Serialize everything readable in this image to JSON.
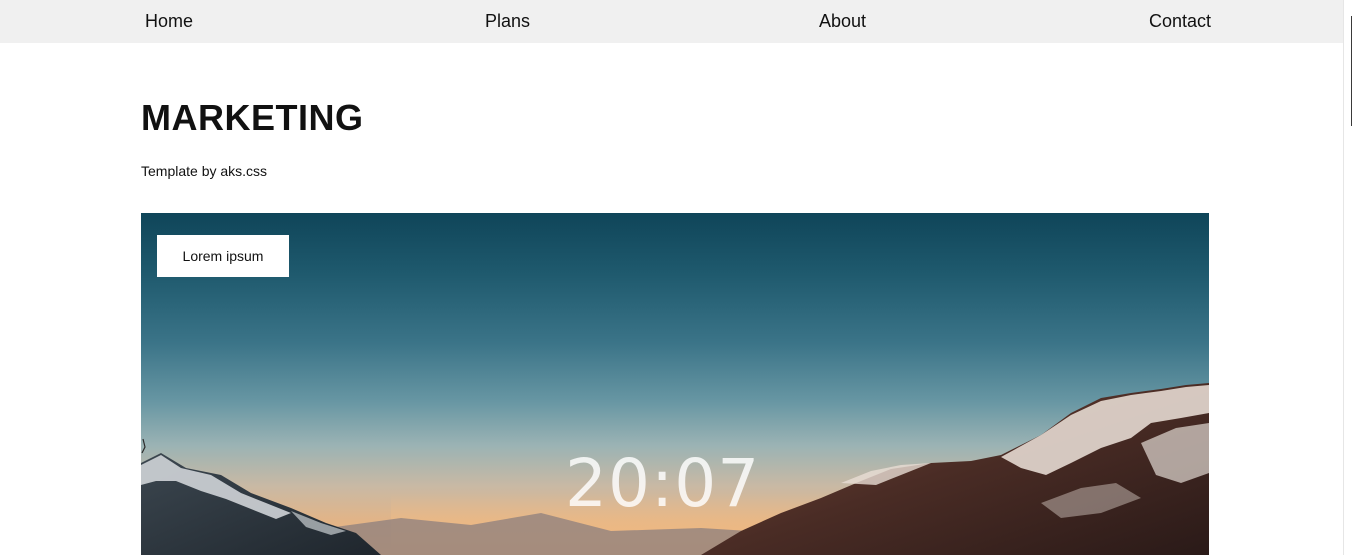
{
  "nav": {
    "items": [
      {
        "label": "Home"
      },
      {
        "label": "Plans"
      },
      {
        "label": "About"
      },
      {
        "label": "Contact"
      }
    ]
  },
  "header": {
    "title": "MARKETING",
    "subtitle": "Template by aks.css"
  },
  "hero": {
    "badge_label": "Lorem ipsum",
    "clock_text": "20:07",
    "image_subject": "mountain sunset landscape"
  },
  "colors": {
    "nav_background": "#f0f0f0",
    "page_background": "#ffffff",
    "text": "#111111",
    "sky_top": "#0f4559",
    "sky_horizon": "#efb27a"
  }
}
